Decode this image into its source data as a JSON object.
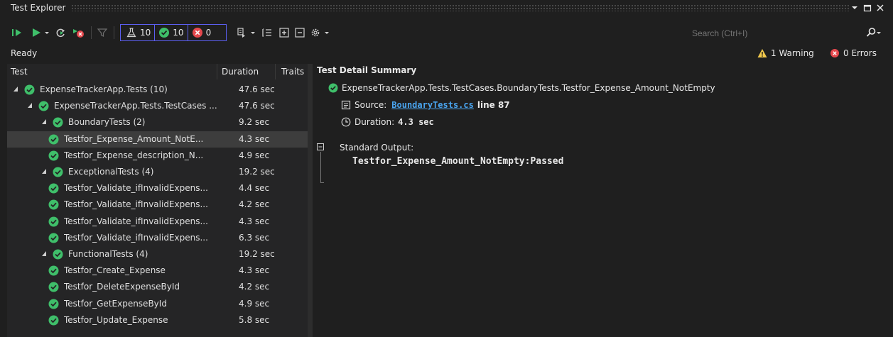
{
  "window": {
    "title": "Test Explorer"
  },
  "toolbar": {
    "total_count": "10",
    "passed_count": "10",
    "failed_count": "0",
    "search_placeholder": "Search (Ctrl+I)"
  },
  "status": {
    "text": "Ready",
    "warnings": "1 Warning",
    "errors": "0 Errors"
  },
  "columns": {
    "test": "Test",
    "duration": "Duration",
    "traits": "Traits"
  },
  "tree": [
    {
      "name": "ExpenseTrackerApp.Tests (10)",
      "duration": "47.6 sec"
    },
    {
      "name": "ExpenseTrackerApp.Tests.TestCases ...",
      "duration": "47.6 sec"
    },
    {
      "name": "BoundaryTests (2)",
      "duration": "9.2 sec"
    },
    {
      "name": "Testfor_Expense_Amount_NotE...",
      "duration": "4.3 sec"
    },
    {
      "name": "Testfor_Expense_description_N...",
      "duration": "4.9 sec"
    },
    {
      "name": "ExceptionalTests (4)",
      "duration": "19.2 sec"
    },
    {
      "name": "Testfor_Validate_ifInvalidExpens...",
      "duration": "4.4 sec"
    },
    {
      "name": "Testfor_Validate_ifInvalidExpens...",
      "duration": "4.2 sec"
    },
    {
      "name": "Testfor_Validate_ifInvalidExpens...",
      "duration": "4.3 sec"
    },
    {
      "name": "Testfor_Validate_ifInvalidExpens...",
      "duration": "6.3 sec"
    },
    {
      "name": "FunctionalTests (4)",
      "duration": "19.2 sec"
    },
    {
      "name": "Testfor_Create_Expense",
      "duration": "4.3 sec"
    },
    {
      "name": "Testfor_DeleteExpenseById",
      "duration": "4.2 sec"
    },
    {
      "name": "Testfor_GetExpenseById",
      "duration": "4.9 sec"
    },
    {
      "name": "Testfor_Update_Expense",
      "duration": "5.8 sec"
    }
  ],
  "detail": {
    "title": "Test Detail Summary",
    "test_name": "ExpenseTrackerApp.Tests.TestCases.BoundaryTests.Testfor_Expense_Amount_NotEmpty",
    "source_label": "Source:",
    "source_file": "BoundaryTests.cs",
    "source_line": "line 87",
    "duration_label": "Duration:",
    "duration_value": "4.3 sec",
    "output_label": "Standard Output:",
    "output_text": "Testfor_Expense_Amount_NotEmpty:Passed"
  },
  "colors": {
    "pass": "#3fbf6a",
    "fail": "#e5484d",
    "accent": "#5b5ef0",
    "warning": "#f2c94c",
    "link": "#4aa5f0"
  }
}
